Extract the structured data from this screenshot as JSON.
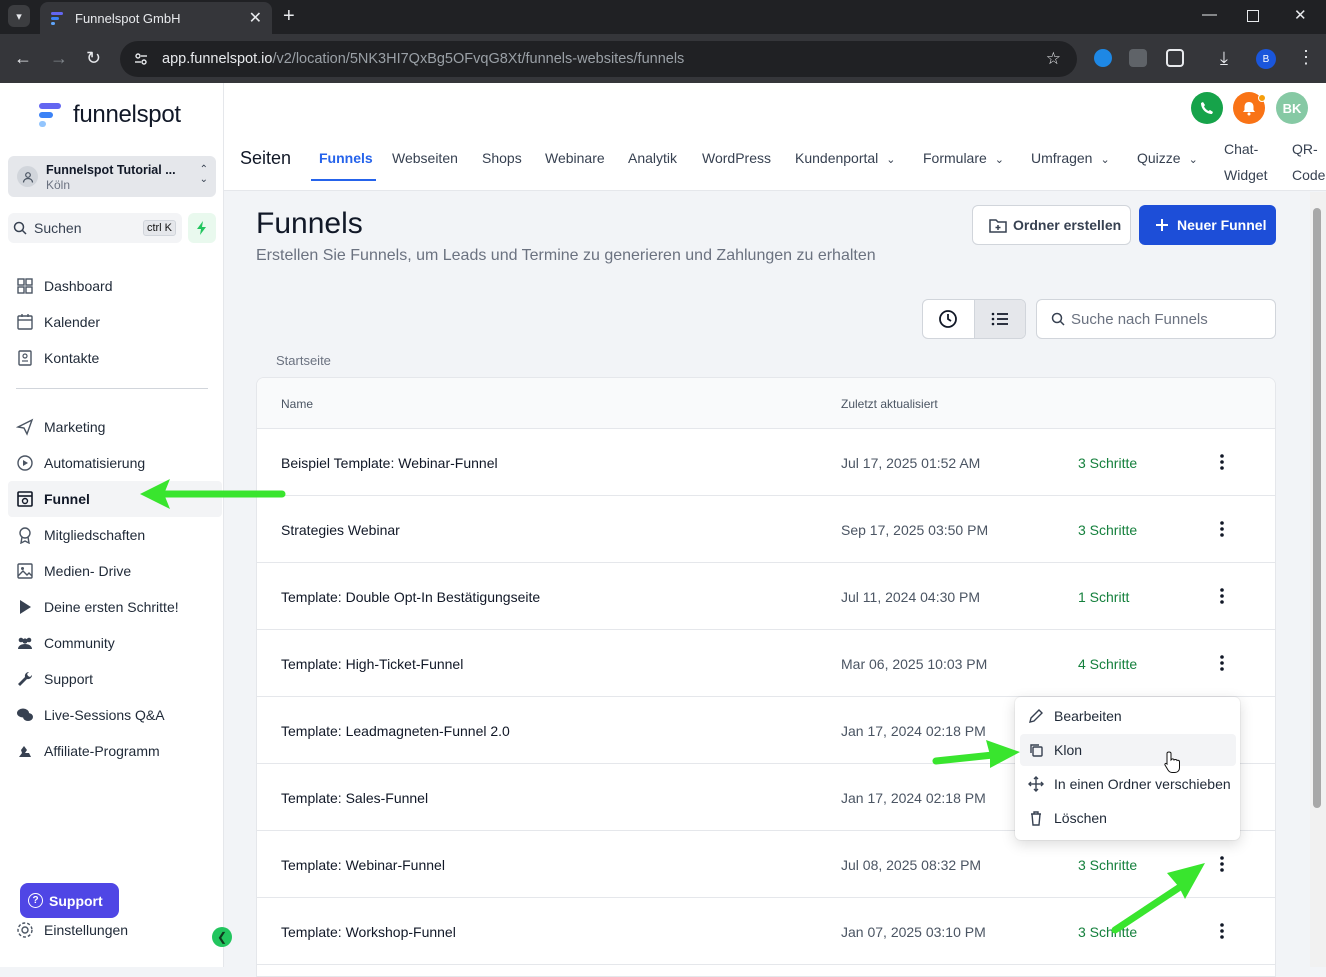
{
  "browser": {
    "tab_title": "Funnelspot GmbH",
    "url_domain": "app.funnelspot.io",
    "url_path": "/v2/location/5NK3HI7QxBg5OFvqG8Xt/funnels-websites/funnels",
    "profile_initial": "B"
  },
  "sidebar": {
    "logo_text": "funnelspot",
    "location": {
      "name": "Funnelspot Tutorial ...",
      "city": "Köln"
    },
    "search_label": "Suchen",
    "search_shortcut": "ctrl K",
    "items": [
      {
        "label": "Dashboard",
        "icon": "dashboard-icon"
      },
      {
        "label": "Kalender",
        "icon": "calendar-icon"
      },
      {
        "label": "Kontakte",
        "icon": "contacts-icon"
      },
      {
        "label": "Marketing",
        "icon": "send-icon"
      },
      {
        "label": "Automatisierung",
        "icon": "automation-icon"
      },
      {
        "label": "Funnel",
        "icon": "funnel-icon",
        "active": true
      },
      {
        "label": "Mitgliedschaften",
        "icon": "award-icon"
      },
      {
        "label": "Medien- Drive",
        "icon": "image-icon"
      },
      {
        "label": "Deine ersten Schritte!",
        "icon": "play-icon"
      },
      {
        "label": "Community",
        "icon": "community-icon"
      },
      {
        "label": "Support",
        "icon": "wrench-icon"
      },
      {
        "label": "Live-Sessions Q&A",
        "icon": "chat-icon"
      },
      {
        "label": "Affiliate-Programm",
        "icon": "affiliate-icon"
      }
    ],
    "support_button": "Support",
    "settings_label": "Einstellungen"
  },
  "topbar": {
    "avatar_initials": "BK",
    "section_title": "Seiten",
    "tabs": [
      {
        "label": "Funnels",
        "active": true
      },
      {
        "label": "Webseiten"
      },
      {
        "label": "Shops"
      },
      {
        "label": "Webinare"
      },
      {
        "label": "Analytik"
      },
      {
        "label": "WordPress"
      },
      {
        "label": "Kundenportal",
        "dropdown": true
      },
      {
        "label": "Formulare",
        "dropdown": true
      },
      {
        "label": "Umfragen",
        "dropdown": true
      },
      {
        "label": "Quizze",
        "dropdown": true
      }
    ],
    "chat_widget": [
      "Chat-",
      "Widget"
    ],
    "qr_code": [
      "QR-",
      "Code"
    ]
  },
  "page": {
    "title": "Funnels",
    "subtitle": "Erstellen Sie Funnels, um Leads und Termine zu generieren und Zahlungen zu erhalten",
    "btn_create_folder": "Ordner erstellen",
    "btn_new_funnel": "Neuer Funnel",
    "search_placeholder": "Suche nach Funnels",
    "breadcrumb": "Startseite"
  },
  "table": {
    "col_name": "Name",
    "col_updated": "Zuletzt aktualisiert",
    "rows": [
      {
        "name": "Beispiel Template: Webinar-Funnel",
        "updated": "Jul 17, 2025 01:52 AM",
        "steps": "3 Schritte"
      },
      {
        "name": "Strategies Webinar",
        "updated": "Sep 17, 2025 03:50 PM",
        "steps": "3 Schritte"
      },
      {
        "name": "Template: Double Opt-In Bestätigungseite",
        "updated": "Jul 11, 2024 04:30 PM",
        "steps": "1 Schritt"
      },
      {
        "name": "Template: High-Ticket-Funnel",
        "updated": "Mar 06, 2025 10:03 PM",
        "steps": "4 Schritte"
      },
      {
        "name": "Template: Leadmagneten-Funnel 2.0",
        "updated": "Jan 17, 2024 02:18 PM",
        "steps": ""
      },
      {
        "name": "Template: Sales-Funnel",
        "updated": "Jan 17, 2024 02:18 PM",
        "steps": ""
      },
      {
        "name": "Template: Webinar-Funnel",
        "updated": "Jul 08, 2025 08:32 PM",
        "steps": "3 Schritte"
      },
      {
        "name": "Template: Workshop-Funnel",
        "updated": "Jan 07, 2025 03:10 PM",
        "steps": "3 Schritte"
      }
    ]
  },
  "context_menu": {
    "items": [
      {
        "label": "Bearbeiten",
        "icon": "pencil-icon"
      },
      {
        "label": "Klon",
        "icon": "copy-icon",
        "hovered": true
      },
      {
        "label": "In einen Ordner verschieben",
        "icon": "move-icon"
      },
      {
        "label": "Löschen",
        "icon": "trash-icon"
      }
    ]
  },
  "colors": {
    "accent": "#2563eb",
    "primary_button": "#1d4ed8",
    "step_green": "#15803d",
    "annotation_arrow": "#39e52e"
  }
}
